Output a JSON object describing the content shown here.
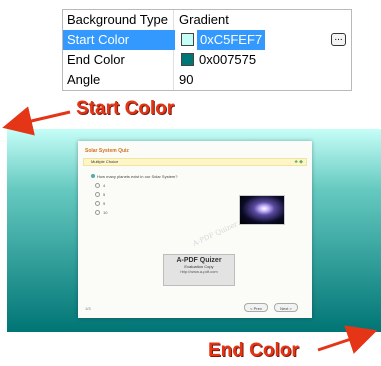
{
  "property_grid": {
    "rows": [
      {
        "label": "Background Type",
        "value": "Gradient"
      },
      {
        "label": "Start Color",
        "value": "0xC5FEF7",
        "swatch": "#c5fef7",
        "selected": true
      },
      {
        "label": "End Color",
        "value": "0x007575",
        "swatch": "#007575"
      },
      {
        "label": "Angle",
        "value": "90"
      }
    ],
    "ellipsis_button": "..."
  },
  "annotations": {
    "start_color": "Start Color",
    "end_color": "End Color"
  },
  "preview": {
    "quiz_title": "Solar System Quiz",
    "bar_label": "Multiple Choice",
    "bar_icons": "♣ ◆",
    "question": "How many planets exist in our Solar System?",
    "options": [
      "4",
      "5",
      "9",
      "10"
    ],
    "watermark": "A-PDF Quizer",
    "stamp_title": "A-PDF Quizer",
    "stamp_subtitle": "Evaluation Copy",
    "stamp_url": "http://www.a-pdf.com",
    "page_indicator": "1/3",
    "prev_button": "< Prev",
    "next_button": "Next >"
  },
  "colors": {
    "accent": "#3399ff",
    "annotation": "#e53517",
    "start": "#c5fef7",
    "end": "#007575"
  }
}
